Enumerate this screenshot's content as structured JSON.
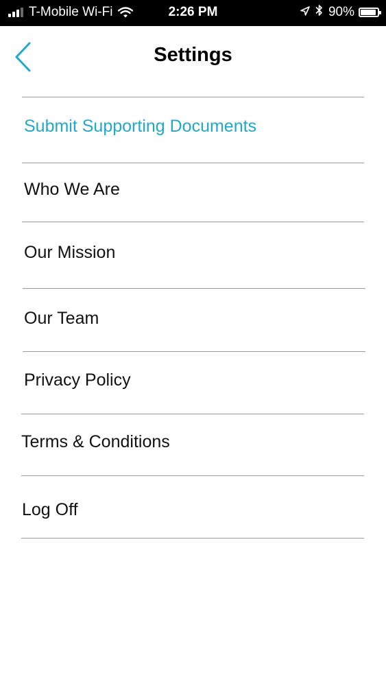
{
  "status_bar": {
    "carrier": "T-Mobile Wi-Fi",
    "time": "2:26 PM",
    "battery_percent": "90%",
    "battery_level": 0.9,
    "signal_bars": 4,
    "signal_bars_active": 3,
    "icons": [
      "signal-icon",
      "wifi-icon",
      "location-arrow-icon",
      "bluetooth-icon",
      "battery-icon"
    ]
  },
  "header": {
    "title": "Settings",
    "back_icon": "chevron-left-icon"
  },
  "menu": {
    "items": [
      {
        "label": "Submit Supporting Documents",
        "highlighted": true
      },
      {
        "label": "Who We Are",
        "highlighted": false
      },
      {
        "label": "Our Mission",
        "highlighted": false
      },
      {
        "label": "Our Team",
        "highlighted": false
      },
      {
        "label": "Privacy Policy",
        "highlighted": false
      },
      {
        "label": "Terms & Conditions",
        "highlighted": false
      },
      {
        "label": "Log Off",
        "highlighted": false
      }
    ]
  },
  "colors": {
    "accent": "#20a9c9",
    "divider": "#9a9a9a",
    "status_bar_bg": "#000000",
    "text": "#111111"
  }
}
